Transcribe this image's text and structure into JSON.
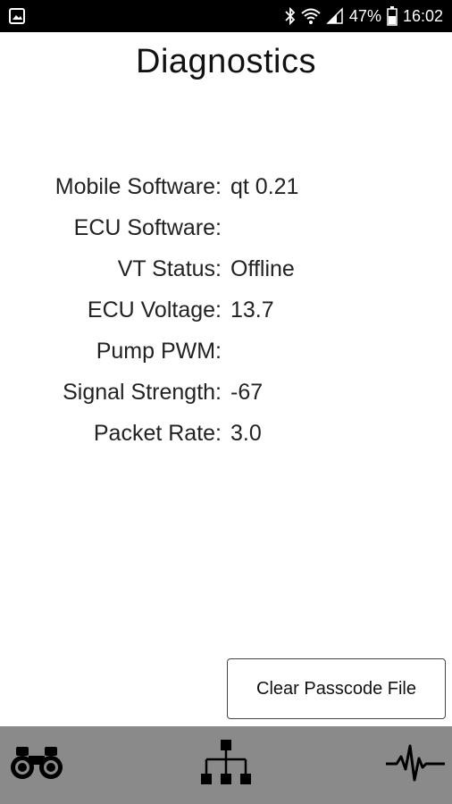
{
  "status_bar": {
    "battery": "47%",
    "time": "16:02",
    "icons": [
      "image-icon",
      "bluetooth-icon",
      "wifi-icon",
      "cell-signal-icon",
      "battery-icon"
    ]
  },
  "page": {
    "title": "Diagnostics"
  },
  "diagnostics": [
    {
      "label": "Mobile Software:",
      "value": "qt 0.21"
    },
    {
      "label": "ECU Software:",
      "value": ""
    },
    {
      "label": "VT Status:",
      "value": "Offline"
    },
    {
      "label": "ECU Voltage:",
      "value": "13.7"
    },
    {
      "label": "Pump PWM:",
      "value": ""
    },
    {
      "label": "Signal Strength:",
      "value": "-67"
    },
    {
      "label": "Packet Rate:",
      "value": "3.0"
    }
  ],
  "actions": {
    "clear_passcode": "Clear Passcode File"
  },
  "nav": {
    "items": [
      "binoculars-icon",
      "network-tree-icon",
      "waveform-icon"
    ],
    "bar_color": "#8a8a8a"
  }
}
